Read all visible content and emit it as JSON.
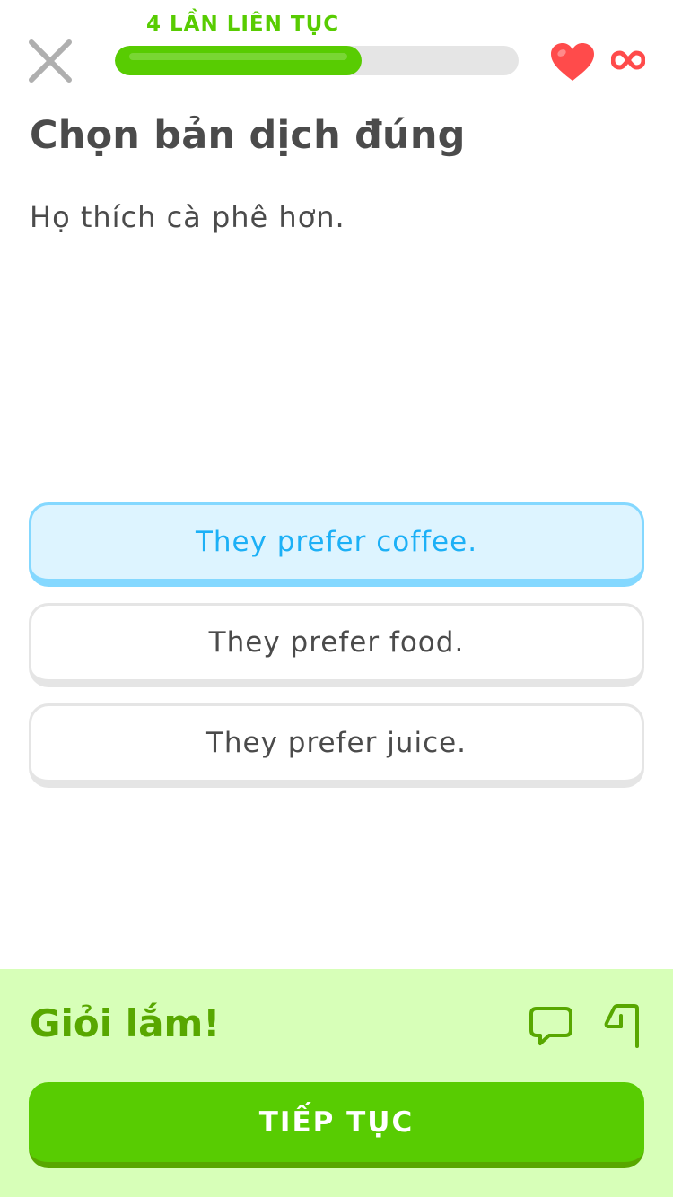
{
  "header": {
    "streak_label": "4 LẦN LIÊN TỤC",
    "progress_fraction": 0.61,
    "hearts": "∞"
  },
  "challenge": {
    "title": "Chọn bản dịch đúng",
    "prompt": "Họ thích cà phê hơn.",
    "choices": [
      {
        "label": "They prefer coffee.",
        "selected": true
      },
      {
        "label": "They prefer food.",
        "selected": false
      },
      {
        "label": "They prefer juice.",
        "selected": false
      }
    ]
  },
  "feedback": {
    "title": "Giỏi lắm!",
    "continue_label": "TIẾP TỤC"
  },
  "colors": {
    "accent": "#58cc02",
    "accent_dark": "#58a700",
    "selected_bg": "#ddf4ff",
    "selected_border": "#84d8ff",
    "selected_text": "#1cb0f6",
    "heart": "#ff4b4b",
    "feedback_bg": "#d7ffb8"
  },
  "icons": {
    "close": "close-icon",
    "heart": "heart-icon",
    "infinity": "infinity-icon",
    "report": "chat-bubble-icon",
    "flag": "flag-icon"
  }
}
